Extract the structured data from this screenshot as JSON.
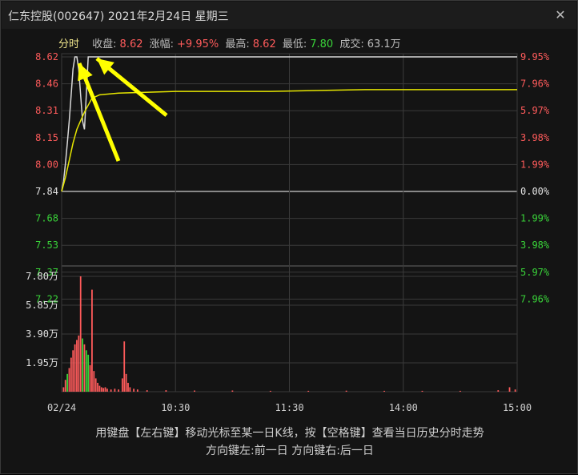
{
  "window": {
    "title": "仁东控股(002647) 2021年2月24日 星期三",
    "close_glyph": "✕"
  },
  "info": {
    "tab": "分时",
    "close_label": "收盘:",
    "close_value": "8.62",
    "change_label": "涨幅:",
    "change_value": "+9.95%",
    "high_label": "最高:",
    "high_value": "8.62",
    "low_label": "最低:",
    "low_value": "7.80",
    "volume_label": "成交:",
    "volume_value": "63.1万"
  },
  "hint": {
    "line1": "用键盘【左右键】移动光标至某一日K线，按【空格键】查看当日历史分时走势",
    "line2": "方向键左:前一日  方向键右:后一日"
  },
  "colors": {
    "price_line": "#d9d9d9",
    "avg_line": "#e6e600",
    "up": "#ff5b5b",
    "down": "#39d339",
    "grid": "#3a3a3a",
    "arrow": "#ffff00"
  },
  "chart_data": [
    {
      "type": "line",
      "name": "price",
      "y_ticks_left": [
        "8.62",
        "8.46",
        "8.31",
        "8.15",
        "8.00",
        "7.84",
        "7.68",
        "7.53",
        "7.37",
        "7.22"
      ],
      "y_ticks_right": [
        "9.95%",
        "7.96%",
        "5.97%",
        "3.98%",
        "1.99%",
        "0.00%",
        "1.99%",
        "3.98%",
        "5.97%",
        "7.96%"
      ],
      "ylim": [
        7.06,
        8.62
      ],
      "prev_close": 7.84,
      "series": [
        {
          "name": "price",
          "x": [
            0,
            1,
            2,
            3,
            4,
            5,
            6,
            7,
            8,
            9,
            10,
            11,
            12,
            13,
            14,
            15,
            240
          ],
          "values": [
            7.84,
            7.9,
            8.0,
            8.12,
            8.25,
            8.4,
            8.55,
            8.62,
            8.62,
            8.55,
            8.4,
            8.25,
            8.2,
            8.4,
            8.62,
            8.62,
            8.62
          ]
        },
        {
          "name": "avg",
          "x": [
            0,
            2,
            4,
            6,
            8,
            10,
            12,
            14,
            16,
            20,
            30,
            60,
            110,
            160,
            240
          ],
          "values": [
            7.84,
            7.92,
            8.02,
            8.12,
            8.2,
            8.25,
            8.3,
            8.34,
            8.38,
            8.4,
            8.41,
            8.42,
            8.42,
            8.43,
            8.43
          ]
        }
      ]
    },
    {
      "type": "bar",
      "name": "volume",
      "y_ticks": [
        "7.80万",
        "5.85万",
        "3.90万",
        "1.95万"
      ],
      "ylim": [
        0,
        7.8
      ],
      "x_ticks": [
        "02/24",
        "10:30",
        "11:30",
        "14:00",
        "15:00"
      ],
      "x_tick_positions": [
        0,
        60,
        120,
        180,
        240
      ],
      "bars": [
        {
          "x": 1,
          "v": 0.3,
          "c": "up"
        },
        {
          "x": 2,
          "v": 0.8,
          "c": "up"
        },
        {
          "x": 3,
          "v": 1.2,
          "c": "down"
        },
        {
          "x": 4,
          "v": 1.6,
          "c": "up"
        },
        {
          "x": 5,
          "v": 2.3,
          "c": "up"
        },
        {
          "x": 6,
          "v": 2.8,
          "c": "up"
        },
        {
          "x": 7,
          "v": 3.2,
          "c": "up"
        },
        {
          "x": 8,
          "v": 3.5,
          "c": "up"
        },
        {
          "x": 9,
          "v": 3.8,
          "c": "up"
        },
        {
          "x": 10,
          "v": 7.8,
          "c": "up"
        },
        {
          "x": 11,
          "v": 3.6,
          "c": "down"
        },
        {
          "x": 12,
          "v": 3.2,
          "c": "up"
        },
        {
          "x": 13,
          "v": 2.8,
          "c": "down"
        },
        {
          "x": 14,
          "v": 2.5,
          "c": "down"
        },
        {
          "x": 15,
          "v": 1.8,
          "c": "up"
        },
        {
          "x": 16,
          "v": 6.9,
          "c": "up"
        },
        {
          "x": 17,
          "v": 1.4,
          "c": "up"
        },
        {
          "x": 18,
          "v": 0.9,
          "c": "up"
        },
        {
          "x": 19,
          "v": 0.6,
          "c": "up"
        },
        {
          "x": 20,
          "v": 0.4,
          "c": "up"
        },
        {
          "x": 21,
          "v": 0.3,
          "c": "up"
        },
        {
          "x": 22,
          "v": 0.25,
          "c": "up"
        },
        {
          "x": 23,
          "v": 0.3,
          "c": "up"
        },
        {
          "x": 24,
          "v": 0.2,
          "c": "up"
        },
        {
          "x": 26,
          "v": 0.15,
          "c": "up"
        },
        {
          "x": 28,
          "v": 0.2,
          "c": "up"
        },
        {
          "x": 30,
          "v": 0.15,
          "c": "up"
        },
        {
          "x": 32,
          "v": 0.9,
          "c": "up"
        },
        {
          "x": 33,
          "v": 3.4,
          "c": "up"
        },
        {
          "x": 34,
          "v": 1.2,
          "c": "up"
        },
        {
          "x": 35,
          "v": 0.6,
          "c": "up"
        },
        {
          "x": 36,
          "v": 0.3,
          "c": "up"
        },
        {
          "x": 38,
          "v": 0.2,
          "c": "up"
        },
        {
          "x": 40,
          "v": 0.15,
          "c": "up"
        },
        {
          "x": 45,
          "v": 0.1,
          "c": "up"
        },
        {
          "x": 55,
          "v": 0.1,
          "c": "up"
        },
        {
          "x": 70,
          "v": 0.08,
          "c": "up"
        },
        {
          "x": 90,
          "v": 0.08,
          "c": "up"
        },
        {
          "x": 110,
          "v": 0.06,
          "c": "up"
        },
        {
          "x": 130,
          "v": 0.06,
          "c": "up"
        },
        {
          "x": 150,
          "v": 0.07,
          "c": "up"
        },
        {
          "x": 170,
          "v": 0.06,
          "c": "up"
        },
        {
          "x": 190,
          "v": 0.06,
          "c": "up"
        },
        {
          "x": 210,
          "v": 0.06,
          "c": "up"
        },
        {
          "x": 230,
          "v": 0.1,
          "c": "up"
        },
        {
          "x": 236,
          "v": 0.3,
          "c": "up"
        },
        {
          "x": 239,
          "v": 0.15,
          "c": "up"
        }
      ]
    }
  ]
}
